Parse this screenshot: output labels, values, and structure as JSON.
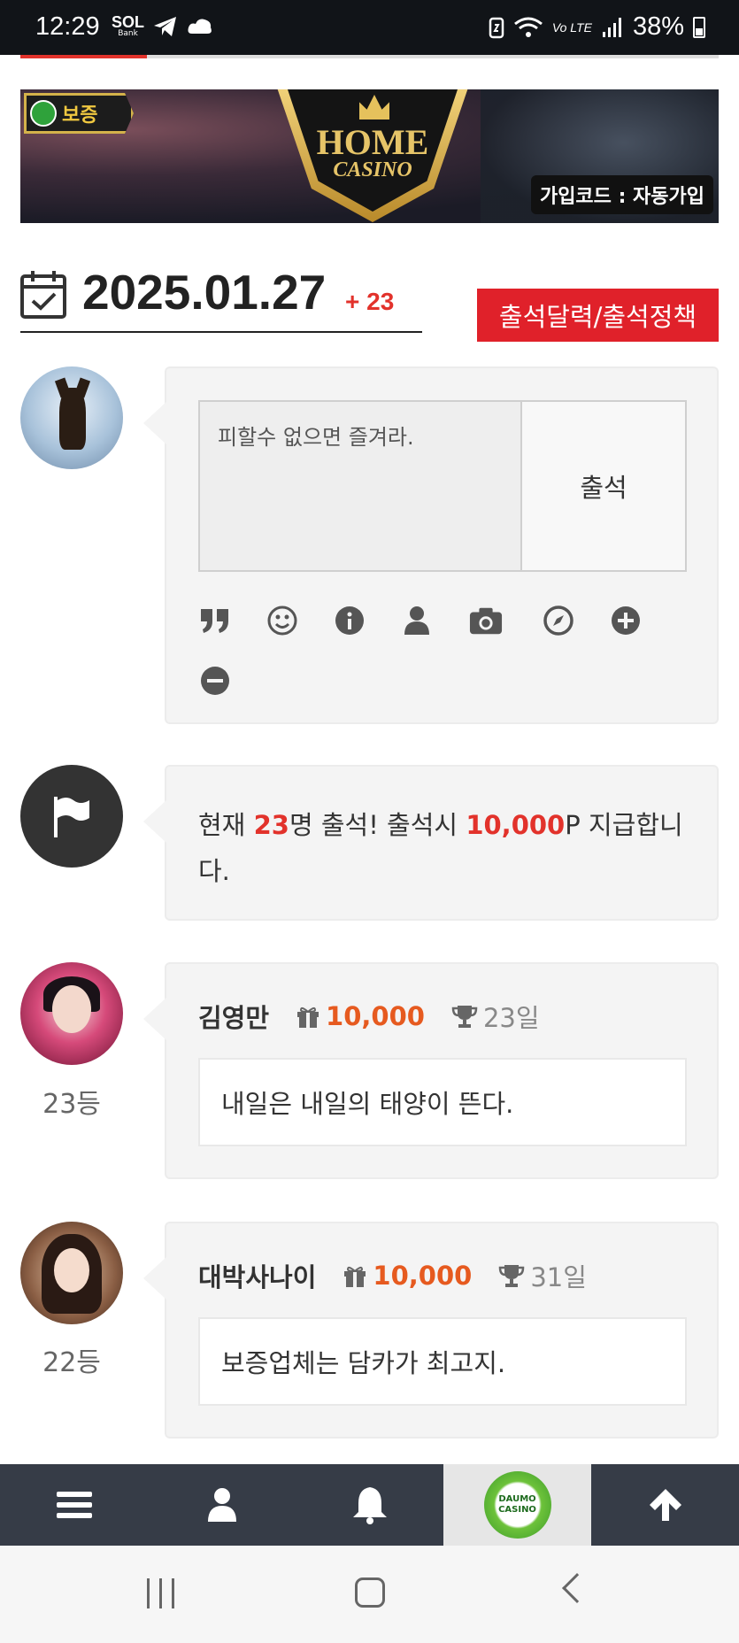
{
  "status_bar": {
    "time": "12:29",
    "bank_label": "Bank",
    "network_label": "Vo LTE",
    "battery": "38%"
  },
  "banner": {
    "badge": "보증",
    "brand_top": "HOME",
    "brand_bottom": "CASINO",
    "join_code": "가입코드 : 자동가입"
  },
  "header": {
    "date": "2025.01.27",
    "count": "+ 23",
    "policy_button": "출석달력/출석정책"
  },
  "attendance_form": {
    "input_value": "피할수 없으면 즐겨라.",
    "submit_label": "출석",
    "toolbar_icons": [
      "quote-icon",
      "smile-icon",
      "info-icon",
      "user-icon",
      "camera-icon",
      "compass-icon",
      "plus-circle-icon",
      "minus-circle-icon"
    ]
  },
  "notice": {
    "prefix": "현재 ",
    "count": "23",
    "middle": "명 출석! 출석시 ",
    "points": "10,000",
    "suffix": "P 지급합니다."
  },
  "entries": [
    {
      "name": "김영만",
      "points": "10,000",
      "days": "23일",
      "message": "내일은 내일의 태양이 뜬다.",
      "rank": "23등"
    },
    {
      "name": "대박사나이",
      "points": "10,000",
      "days": "31일",
      "message": "보증업체는 담카가 최고지.",
      "rank": "22등"
    }
  ],
  "bottom_nav": {
    "items": [
      "menu-icon",
      "user-icon",
      "bell-icon",
      "daumo-casino-logo",
      "arrow-up-icon"
    ],
    "logo_text": "DAUMO CASINO"
  },
  "colors": {
    "accent_red": "#e0212a",
    "points_orange": "#e65a1f",
    "nav_bg": "#363c47"
  }
}
